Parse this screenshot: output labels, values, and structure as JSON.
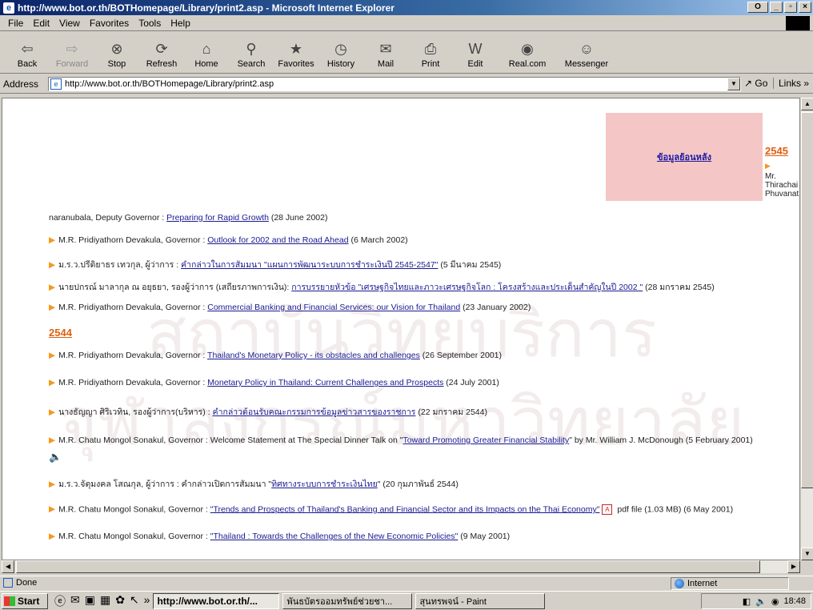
{
  "window": {
    "title": "http://www.bot.or.th/BOTHomepage/Library/print2.asp - Microsoft Internet Explorer",
    "title_icon": "e",
    "buttons": {
      "extra": "O",
      "minimize": "_",
      "maximize": "▫",
      "close": "×"
    }
  },
  "menu": [
    "File",
    "Edit",
    "View",
    "Favorites",
    "Tools",
    "Help"
  ],
  "toolbar": [
    {
      "label": "Back",
      "icon": "back-icon",
      "glyph": "⇦",
      "enabled": true
    },
    {
      "label": "Forward",
      "icon": "forward-icon",
      "glyph": "⇨",
      "enabled": false
    },
    {
      "label": "Stop",
      "icon": "stop-icon",
      "glyph": "⊗",
      "enabled": true
    },
    {
      "label": "Refresh",
      "icon": "refresh-icon",
      "glyph": "⟳",
      "enabled": true
    },
    {
      "label": "Home",
      "icon": "home-icon",
      "glyph": "⌂",
      "enabled": true
    },
    {
      "label": "Search",
      "icon": "search-icon",
      "glyph": "⚲",
      "enabled": true
    },
    {
      "label": "Favorites",
      "icon": "favorites-icon",
      "glyph": "★",
      "enabled": true
    },
    {
      "label": "History",
      "icon": "history-icon",
      "glyph": "◷",
      "enabled": true
    },
    {
      "label": "Mail",
      "icon": "mail-icon",
      "glyph": "✉",
      "enabled": true
    },
    {
      "label": "Print",
      "icon": "print-icon",
      "glyph": "⎙",
      "enabled": true
    },
    {
      "label": "Edit",
      "icon": "edit-icon",
      "glyph": "W",
      "enabled": true
    },
    {
      "label": "Real.com",
      "icon": "realcom-icon",
      "glyph": "◉",
      "enabled": true
    },
    {
      "label": "Messenger",
      "icon": "messenger-icon",
      "glyph": "☺",
      "enabled": true
    }
  ],
  "address": {
    "label": "Address",
    "url": "http://www.bot.or.th/BOTHomepage/Library/print2.asp",
    "go": "Go",
    "links": "Links"
  },
  "content": {
    "sidebar_box_link": "ข้อมูลย้อนหลัง",
    "year_2545": "2545",
    "sidebar_text": [
      "Mr.",
      "Thirachai",
      "Phuvanat"
    ],
    "year_2544": "2544",
    "watermark": "สถาบันวิทยบริการ จุฬาลงกรณ์มหาวิทยาลัย",
    "lines": [
      {
        "prefix": "naranubala, Deputy Governor : ",
        "link": "Preparing for Rapid Growth",
        "suffix": " (28 June 2002)",
        "bullet": false
      },
      {
        "prefix": "M.R. Pridiyathorn Devakula, Governor : ",
        "link": "Outlook for 2002 and the Road Ahead",
        "suffix": " (6 March 2002)",
        "bullet": true
      },
      {
        "prefix": "ม.ร.ว.ปรีดิยาธร เทวกุล, ผู้ว่าการ : ",
        "link": "คำกล่าวในการสัมมนา \"แผนการพัฒนาระบบการชำระเงินปี 2545-2547\"",
        "suffix": " (5 มีนาคม 2545)",
        "bullet": true
      },
      {
        "prefix": "นายปกรณ์ มาลากุล ณ อยุธยา, รองผู้ว่าการ (เสถียรภาพการเงิน): ",
        "link": "การบรรยายหัวข้อ \"เศรษฐกิจไทยและภาวะเศรษฐกิจโลก : โครงสร้างและประเด็นสำคัญในปี 2002 \"",
        "suffix": " (28 มกราคม 2545)",
        "bullet": true
      },
      {
        "prefix": "M.R. Pridiyathorn Devakula, Governor : ",
        "link": "Commercial Banking and Financial Services: our Vision for Thailand",
        "suffix": " (23 January 2002)",
        "bullet": true
      },
      {
        "prefix": "M.R. Pridiyathorn Devakula, Governor : ",
        "link": "Thailand's Monetary Policy - its obstacles and challenges",
        "suffix": " (26 September 2001)",
        "bullet": true
      },
      {
        "prefix": "M.R. Pridiyathorn Devakula, Governor : ",
        "link": "Monetary Policy in Thailand: Current Challenges and Prospects",
        "suffix": " (24 July 2001)",
        "bullet": true
      },
      {
        "prefix": "นางธัญญา ศิริเวทิน, รองผู้ว่าการ(บริหาร) : ",
        "link": "คำกล่าวต้อนรับคณะกรรมการข้อมูลข่าวสารของราชการ",
        "suffix": " (22 มกราคม 2544)",
        "bullet": true
      },
      {
        "prefix": "M.R. Chatu Mongol Sonakul, Governor : Welcome Statement at The Special Dinner Talk on \"",
        "link": "Toward Promoting Greater Financial Stability",
        "suffix": "\" by Mr. William J. McDonough (5 February 2001)",
        "bullet": true
      },
      {
        "prefix": "ม.ร.ว.จัตุมงคล โสณกุล, ผู้ว่าการ : คำกล่าวเปิดการสัมมนา \"",
        "link": "ทิศทางระบบการชำระเงินไทย",
        "suffix": "\" (20 กุมภาพันธ์ 2544)",
        "bullet": true
      },
      {
        "prefix": "M.R. Chatu Mongol Sonakul, Governor : ",
        "link": "\"Trends and Prospects of Thailand's Banking and Financial Sector and its Impacts on the Thai Economy\"",
        "suffix": " pdf file (1.03 MB) (6 May 2001)",
        "bullet": true
      },
      {
        "prefix": "M.R. Chatu Mongol Sonakul, Governor : ",
        "link": "\"Thailand : Towards the Challenges of the New Economic Policies\"",
        "suffix": " (9 May 2001)",
        "bullet": true
      }
    ]
  },
  "status": {
    "text": "Done",
    "zone": "Internet"
  },
  "taskbar": {
    "start": "Start",
    "tasks": [
      "http://www.bot.or.th/...",
      "พันธบัตรออมทรัพย์ช่วยชา...",
      "สุนทรพจน์ - Paint"
    ],
    "clock": "18:48"
  },
  "colors": {
    "accent_bullet": "#f39a1e",
    "year_link": "#e06010",
    "pink_box": "#f5c6c6",
    "link": "#1a1a90"
  }
}
